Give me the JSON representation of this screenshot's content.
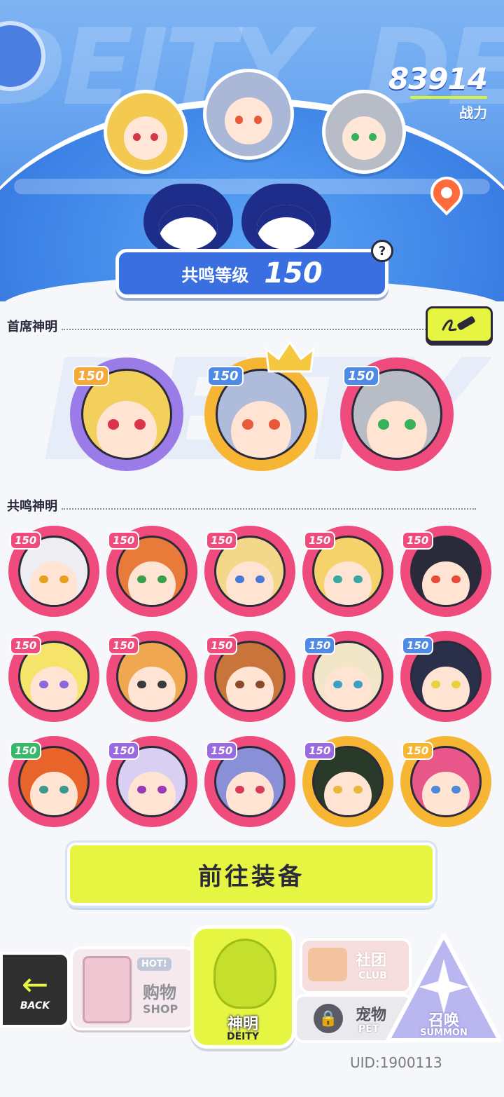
{
  "header": {
    "bg_word": "DEITY",
    "power_value": "83914",
    "power_label": "战力",
    "resonance_label": "共鸣等级",
    "resonance_value": "150",
    "help_glyph": "?"
  },
  "chief": {
    "title": "首席神明",
    "edit_icon": "pencil-icon",
    "avatars": [
      {
        "level": "150",
        "ring": "#9a7be8",
        "badge": "#f4a93a",
        "hair": "#f3cf5c",
        "eye": "#d8344a"
      },
      {
        "level": "150",
        "ring": "#f6b532",
        "badge": "#4e8ae6",
        "hair": "#aebbdb",
        "eye": "#e85a3a",
        "crowned": true
      },
      {
        "level": "150",
        "ring": "#ef4b7c",
        "badge": "#4e8ae6",
        "hair": "#b8bcc4",
        "eye": "#36b25a"
      }
    ]
  },
  "resonance": {
    "title": "共鸣神明",
    "avatars": [
      {
        "level": "150",
        "ring": "#ef4b7c",
        "badge": "#ef4b7c",
        "hair": "#eeeef2",
        "eye": "#e8a020"
      },
      {
        "level": "150",
        "ring": "#ef4b7c",
        "badge": "#ef4b7c",
        "hair": "#e87a3a",
        "eye": "#3aa04a"
      },
      {
        "level": "150",
        "ring": "#ef4b7c",
        "badge": "#ef4b7c",
        "hair": "#f3d88a",
        "eye": "#4a7ad8"
      },
      {
        "level": "150",
        "ring": "#ef4b7c",
        "badge": "#ef4b7c",
        "hair": "#f6d36a",
        "eye": "#3aa8a0"
      },
      {
        "level": "150",
        "ring": "#ef4b7c",
        "badge": "#ef4b7c",
        "hair": "#2a2a3a",
        "eye": "#e84a3a"
      },
      {
        "level": "150",
        "ring": "#ef4b7c",
        "badge": "#ef4b7c",
        "hair": "#f6e36a",
        "eye": "#8a6ad8"
      },
      {
        "level": "150",
        "ring": "#ef4b7c",
        "badge": "#ef4b7c",
        "hair": "#f0a850",
        "eye": "#3a3a3a"
      },
      {
        "level": "150",
        "ring": "#ef4b7c",
        "badge": "#ef4b7c",
        "hair": "#c8743a",
        "eye": "#8a4a2a"
      },
      {
        "level": "150",
        "ring": "#ef4b7c",
        "badge": "#4e8ae6",
        "hair": "#f2e6c8",
        "eye": "#3aa0c8"
      },
      {
        "level": "150",
        "ring": "#ef4b7c",
        "badge": "#4e8ae6",
        "hair": "#2a2f4a",
        "eye": "#e8d040"
      },
      {
        "level": "150",
        "ring": "#ef4b7c",
        "badge": "#3ab86a",
        "hair": "#e8642a",
        "eye": "#3a9a8a"
      },
      {
        "level": "150",
        "ring": "#ef4b7c",
        "badge": "#9a6ae0",
        "hair": "#d8cff2",
        "eye": "#9a3ab8"
      },
      {
        "level": "150",
        "ring": "#ef4b7c",
        "badge": "#9a6ae0",
        "hair": "#8a90d8",
        "eye": "#d83a5a"
      },
      {
        "level": "150",
        "ring": "#f6b532",
        "badge": "#9a6ae0",
        "hair": "#2a3a2a",
        "eye": "#e8b83a"
      },
      {
        "level": "150",
        "ring": "#f6b532",
        "badge": "#f6b532",
        "hair": "#e8568a",
        "eye": "#4a8ad8"
      }
    ]
  },
  "equip_button": "前往装备",
  "nav": {
    "back_label": "BACK",
    "shop_hot": "HOT!",
    "shop_cn": "购物",
    "shop_en": "SHOP",
    "deity_cn": "神明",
    "deity_en": "DEITY",
    "club_cn": "社团",
    "club_en": "CLUB",
    "pet_cn": "宠物",
    "pet_en": "PET",
    "summon_cn": "召唤",
    "summon_en": "SUMMON"
  },
  "uid": "UID:1900113"
}
